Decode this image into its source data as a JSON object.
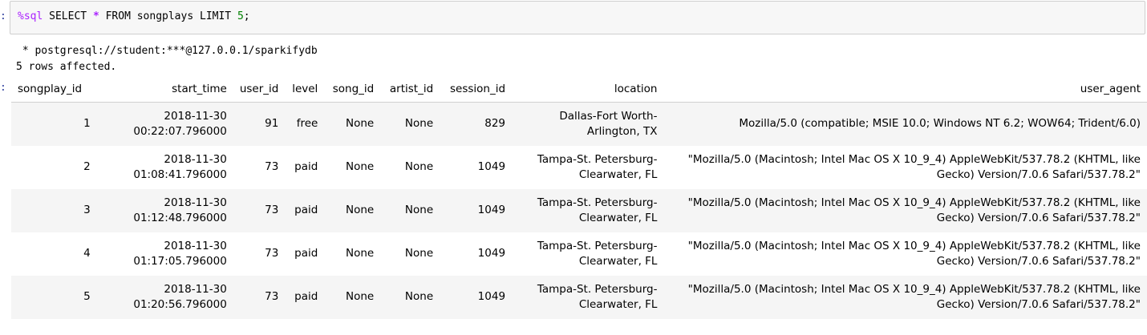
{
  "cell": {
    "in_prompt": ":",
    "out_prompt": ":",
    "code": {
      "magic": "%sql",
      "part1": " SELECT ",
      "star": "*",
      "part2": " FROM songplays LIMIT ",
      "limit": "5",
      "end": ";"
    },
    "output_lines": [
      " * postgresql://student:***@127.0.0.1/sparkifydb",
      "5 rows affected."
    ]
  },
  "table": {
    "columns": [
      "songplay_id",
      "start_time",
      "user_id",
      "level",
      "song_id",
      "artist_id",
      "session_id",
      "location",
      "user_agent"
    ],
    "rows": [
      {
        "songplay_id": "1",
        "start_time": [
          "2018-11-30",
          "00:22:07.796000"
        ],
        "user_id": "91",
        "level": "free",
        "song_id": "None",
        "artist_id": "None",
        "session_id": "829",
        "location": [
          "Dallas-Fort Worth-",
          "Arlington, TX"
        ],
        "user_agent": [
          "Mozilla/5.0 (compatible; MSIE 10.0; Windows NT 6.2; WOW64; Trident/6.0)"
        ]
      },
      {
        "songplay_id": "2",
        "start_time": [
          "2018-11-30",
          "01:08:41.796000"
        ],
        "user_id": "73",
        "level": "paid",
        "song_id": "None",
        "artist_id": "None",
        "session_id": "1049",
        "location": [
          "Tampa-St. Petersburg-",
          "Clearwater, FL"
        ],
        "user_agent": [
          "\"Mozilla/5.0 (Macintosh; Intel Mac OS X 10_9_4) AppleWebKit/537.78.2 (KHTML, like",
          "Gecko) Version/7.0.6 Safari/537.78.2\""
        ]
      },
      {
        "songplay_id": "3",
        "start_time": [
          "2018-11-30",
          "01:12:48.796000"
        ],
        "user_id": "73",
        "level": "paid",
        "song_id": "None",
        "artist_id": "None",
        "session_id": "1049",
        "location": [
          "Tampa-St. Petersburg-",
          "Clearwater, FL"
        ],
        "user_agent": [
          "\"Mozilla/5.0 (Macintosh; Intel Mac OS X 10_9_4) AppleWebKit/537.78.2 (KHTML, like",
          "Gecko) Version/7.0.6 Safari/537.78.2\""
        ]
      },
      {
        "songplay_id": "4",
        "start_time": [
          "2018-11-30",
          "01:17:05.796000"
        ],
        "user_id": "73",
        "level": "paid",
        "song_id": "None",
        "artist_id": "None",
        "session_id": "1049",
        "location": [
          "Tampa-St. Petersburg-",
          "Clearwater, FL"
        ],
        "user_agent": [
          "\"Mozilla/5.0 (Macintosh; Intel Mac OS X 10_9_4) AppleWebKit/537.78.2 (KHTML, like",
          "Gecko) Version/7.0.6 Safari/537.78.2\""
        ]
      },
      {
        "songplay_id": "5",
        "start_time": [
          "2018-11-30",
          "01:20:56.796000"
        ],
        "user_id": "73",
        "level": "paid",
        "song_id": "None",
        "artist_id": "None",
        "session_id": "1049",
        "location": [
          "Tampa-St. Petersburg-",
          "Clearwater, FL"
        ],
        "user_agent": [
          "\"Mozilla/5.0 (Macintosh; Intel Mac OS X 10_9_4) AppleWebKit/537.78.2 (KHTML, like",
          "Gecko) Version/7.0.6 Safari/537.78.2\""
        ]
      }
    ]
  }
}
